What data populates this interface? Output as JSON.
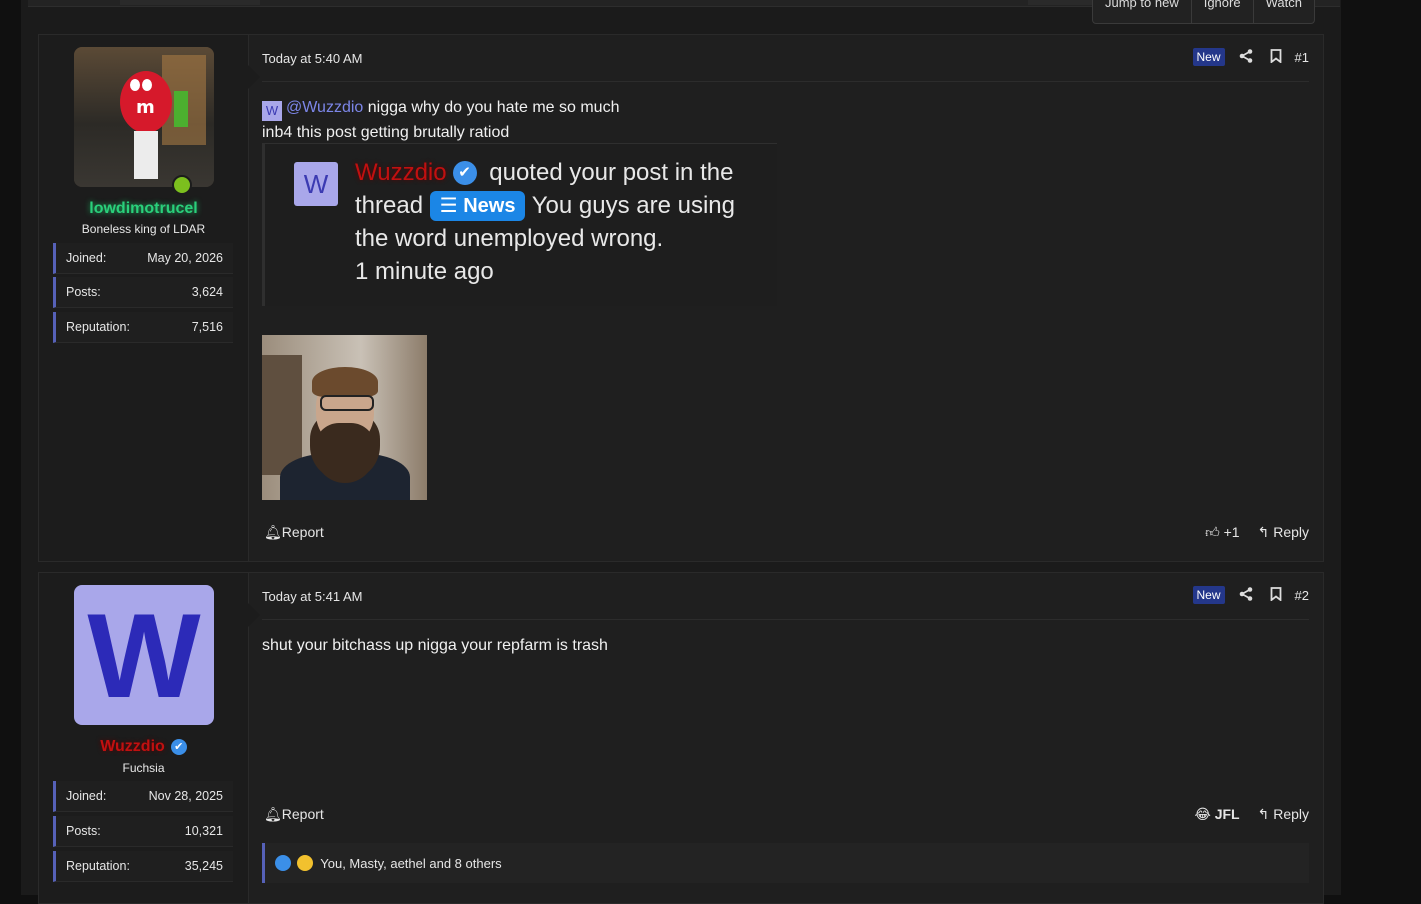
{
  "thread_actions": [
    "Jump to new",
    "Ignore",
    "Watch"
  ],
  "posts": [
    {
      "user": {
        "name": "lowdimotrucel",
        "title": "Boneless king of LDAR",
        "online": true,
        "stats": [
          {
            "label": "Joined:",
            "value": "May 20, 2026"
          },
          {
            "label": "Posts:",
            "value": "3,624"
          },
          {
            "label": "Reputation:",
            "value": "7,516"
          }
        ]
      },
      "date": "Today at 5:40 AM",
      "badge": "New",
      "number": "#1",
      "mention_avatar": "W",
      "mention": "@Wuzzdio",
      "line1": " nigga why do you hate me so much",
      "line2": "inb4 this post getting brutally ratiod",
      "embed": {
        "avatar": "W",
        "name": "Wuzzdio",
        "text_a": " quoted your post in the thread ",
        "chip": "News",
        "text_b": " You guys are using the word unemployed wrong.",
        "time": "1 minute ago"
      },
      "report": "Report",
      "reaction_label": "+1",
      "reply": "Reply"
    },
    {
      "user": {
        "name": "Wuzzdio",
        "title": "Fuchsia",
        "avatar_letter": "W",
        "verified": true,
        "stats": [
          {
            "label": "Joined:",
            "value": "Nov 28, 2025"
          },
          {
            "label": "Posts:",
            "value": "10,321"
          },
          {
            "label": "Reputation:",
            "value": "35,245"
          }
        ]
      },
      "date": "Today at 5:41 AM",
      "badge": "New",
      "number": "#2",
      "body": "shut your bitchass up nigga your repfarm is trash",
      "report": "Report",
      "reaction_label": "JFL",
      "reply": "Reply",
      "reactions_summary": "You, Masty, aethel and 8 others"
    }
  ],
  "colors": {
    "accent": "#5661b8",
    "badge_new": "#24378a",
    "mention": "#7c86e8",
    "username_green": "#2ad07b",
    "username_red": "#c11010",
    "verified": "#3b8fe8"
  }
}
